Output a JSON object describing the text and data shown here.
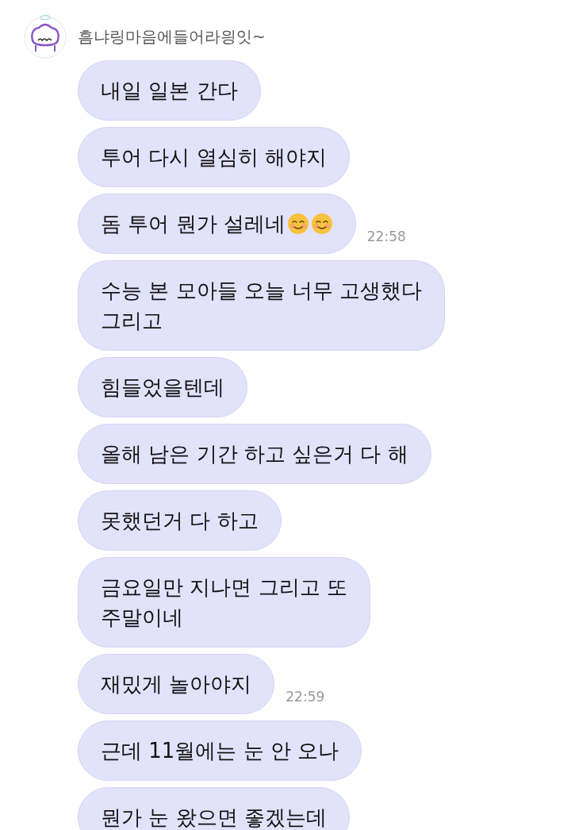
{
  "sender": {
    "name": "흠냐링마음에들어라읭잇~"
  },
  "messages": [
    {
      "lines": [
        "내일 일본 간다"
      ]
    },
    {
      "lines": [
        "투어 다시 열심히 해야지"
      ]
    },
    {
      "lines": [
        "돔 투어 뭔가 설레네"
      ],
      "trailing_icons": [
        {
          "kind": "smile"
        },
        {
          "kind": "smile"
        }
      ],
      "time": "22:58"
    },
    {
      "lines": [
        "수능 본 모아들 오늘 너무 고생했다",
        "그리고"
      ]
    },
    {
      "lines": [
        "힘들었을텐데"
      ]
    },
    {
      "lines": [
        "올해 남은 기간 하고 싶은거 다 해"
      ]
    },
    {
      "lines": [
        "못했던거 다 하고"
      ]
    },
    {
      "lines": [
        "금요일만 지나면 그리고 또",
        "주말이네"
      ]
    },
    {
      "lines": [
        "재밌게 놀아야지"
      ],
      "time": "22:59"
    },
    {
      "lines": [
        "근데 11월에는 눈 안 오나"
      ]
    },
    {
      "lines": [
        "뭔가 눈 왔으면 좋겠는데"
      ]
    }
  ]
}
